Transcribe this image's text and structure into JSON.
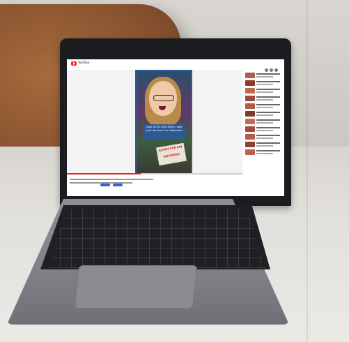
{
  "screen": {
    "app": "YouTube",
    "video_caption": "Dass ist für viele Aktion, aber nicht der Kern ihrer Motivation.",
    "sign_text": "ALPEN FÜR EIN WEITEREN"
  },
  "colors": {
    "cushion": "#8a5430",
    "sofa": "#d8d5d0",
    "laptop": "#7f8085",
    "accent": "#e22"
  },
  "progress": 0.42
}
